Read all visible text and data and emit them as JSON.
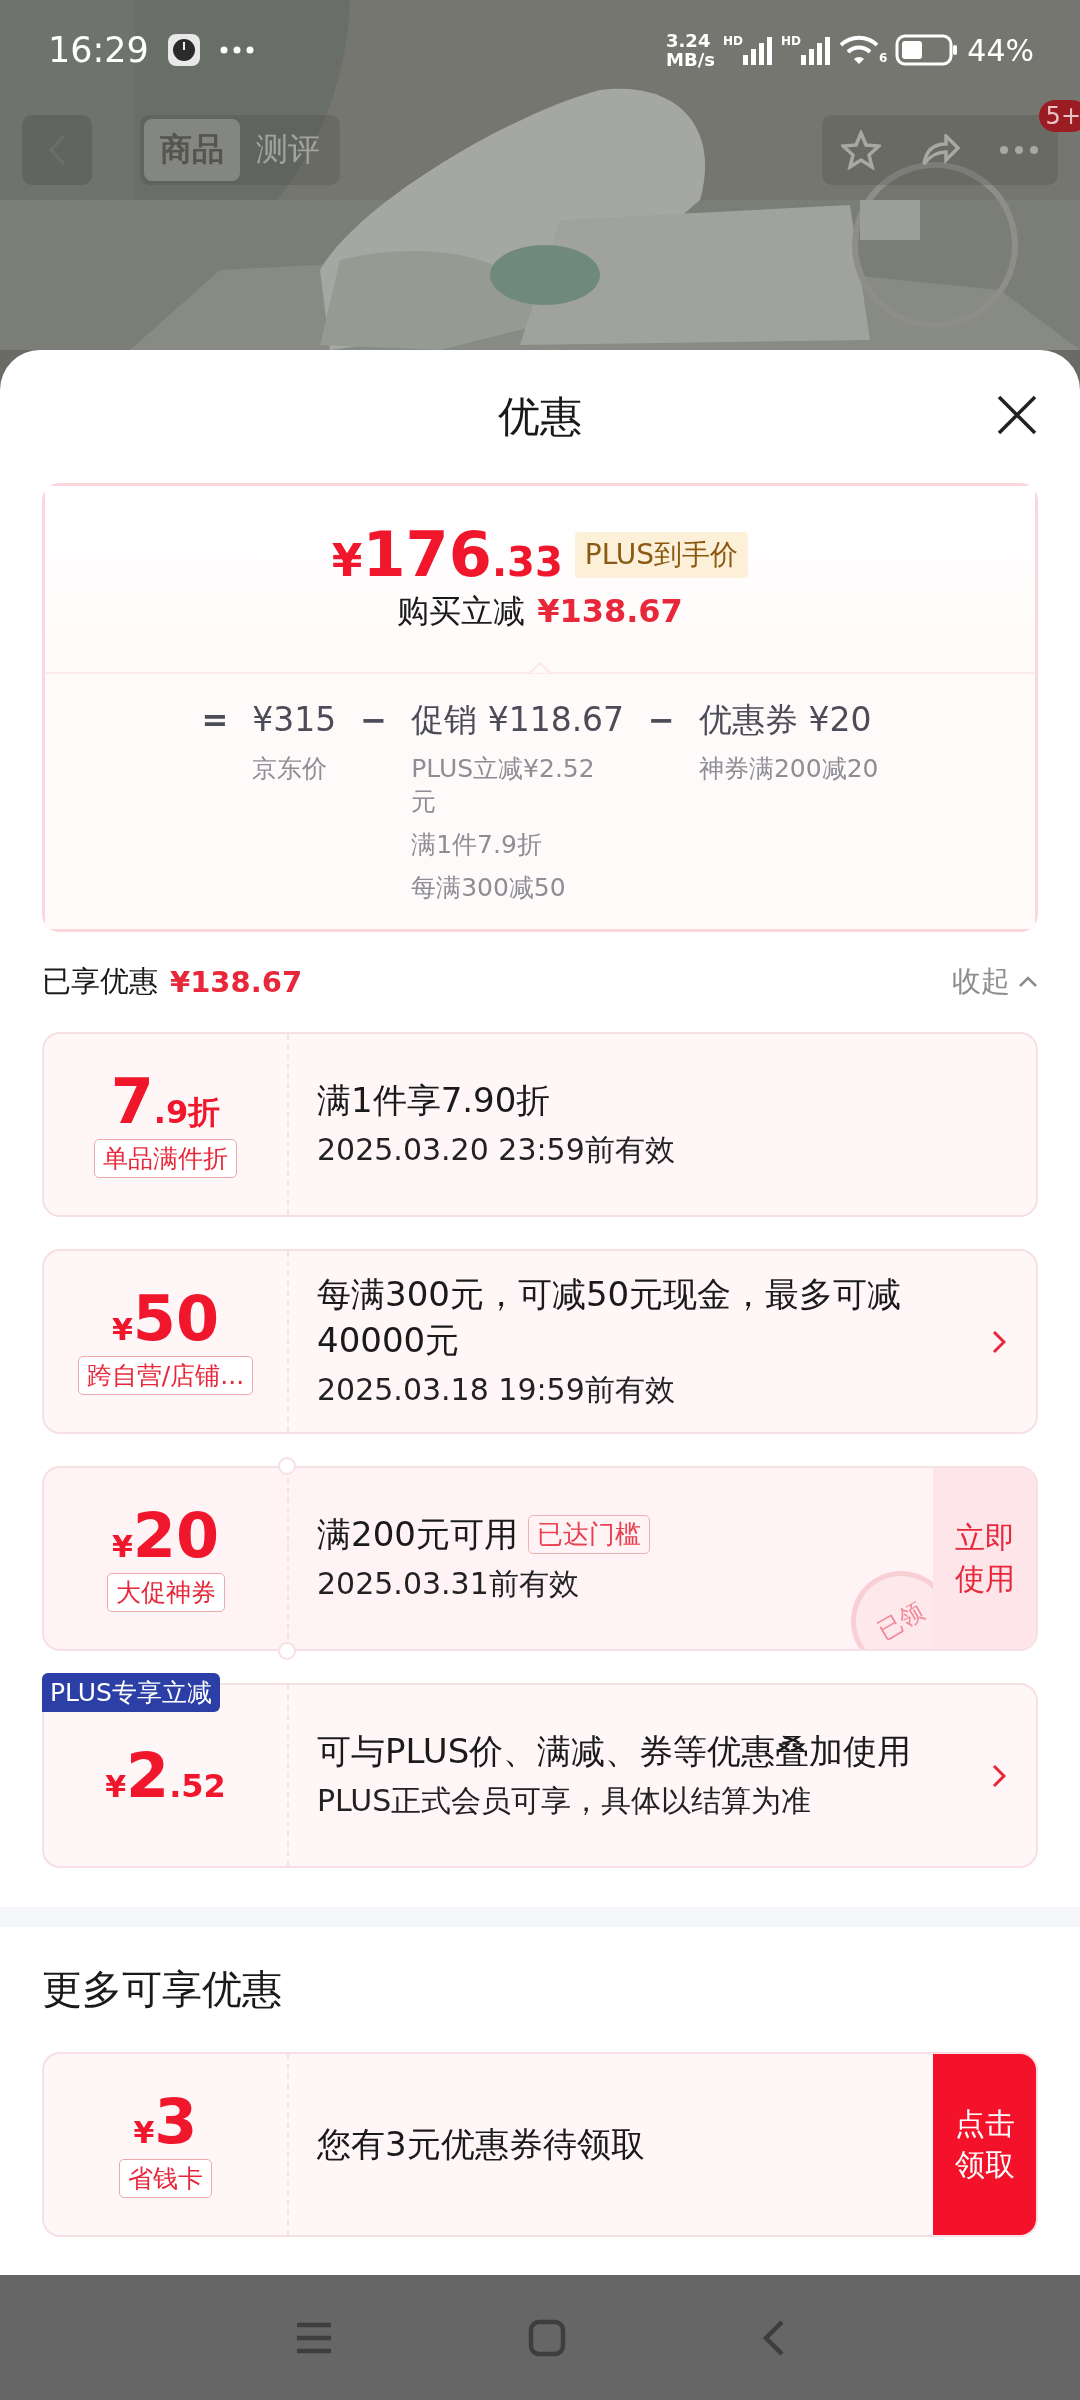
{
  "status_bar": {
    "time": "16:29",
    "speed_value": "3.24",
    "speed_unit": "MB/s",
    "sim_labels": [
      "HD",
      "HD"
    ],
    "wifi_label": "6",
    "battery": "44%"
  },
  "page_header": {
    "tabs": [
      {
        "label": "商品",
        "selected": true
      },
      {
        "label": "测评",
        "selected": false
      }
    ],
    "badge": "5+"
  },
  "sheet": {
    "title": "优惠"
  },
  "summary": {
    "currency": "¥",
    "price_major": "176",
    "price_minor": ".33",
    "price_tag": "PLUS到手价",
    "saving_label": "购买立减",
    "saving_value": "¥138.67",
    "breakdown": [
      {
        "operator": "=",
        "amount": "¥315",
        "notes": [
          "京东价"
        ]
      },
      {
        "operator": "−",
        "amount": "促销 ¥118.67",
        "notes": [
          "PLUS立减¥2.52元",
          "满1件7.9折",
          "每满300减50"
        ]
      },
      {
        "operator": "−",
        "amount": "优惠券 ¥20",
        "notes": [
          "神券满200减20"
        ]
      }
    ]
  },
  "applied": {
    "label": "已享优惠",
    "value": "¥138.67",
    "toggle": "收起",
    "expanded": true
  },
  "coupons": [
    {
      "kind": "plain",
      "major": "7",
      "minor": ".9折",
      "tag": "单品满件折",
      "title": "满1件享7.90折",
      "subtitle": "2025.03.20 23:59前有效",
      "chevron": false
    },
    {
      "kind": "plain",
      "currency": "¥",
      "major": "50",
      "tag": "跨自营/店铺...",
      "title": "每满300元，可减50元现金，最多可减40000元",
      "subtitle": "2025.03.18 19:59前有效",
      "chevron": true
    },
    {
      "kind": "ticket",
      "currency": "¥",
      "major": "20",
      "tag": "大促神券",
      "title": "满200元可用",
      "status": "已达门槛",
      "subtitle": "2025.03.31前有效",
      "chevron": false,
      "action": {
        "label": "立即使用",
        "kind": "soft"
      },
      "stamp": "已领"
    },
    {
      "kind": "plain",
      "corner_label": "PLUS专享立减",
      "currency": "¥",
      "major": "2",
      "minor": ".52",
      "title": "可与PLUS价、满减、券等优惠叠加使用",
      "subtitle": "PLUS正式会员可享，具体以结算为准",
      "chevron": true
    }
  ],
  "more": {
    "title": "更多可享优惠",
    "coupons": [
      {
        "kind": "plain",
        "currency": "¥",
        "major": "3",
        "tag": "省钱卡",
        "title": "您有3元优惠券待领取",
        "chevron": false,
        "action": {
          "label": "点击领取",
          "kind": "solid"
        }
      }
    ]
  }
}
